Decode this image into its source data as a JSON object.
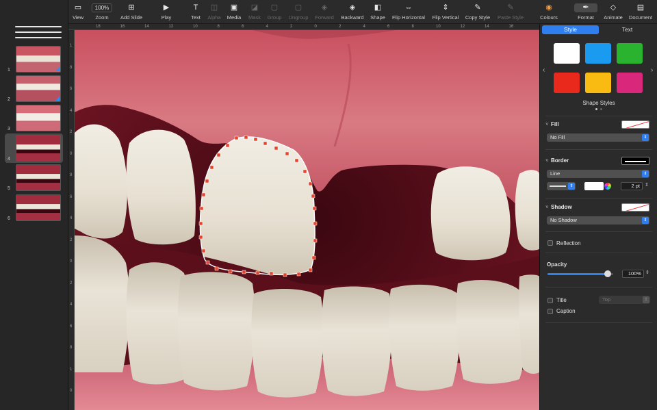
{
  "toolbar": {
    "zoom_value": "100%",
    "items": [
      {
        "label": "View",
        "icon": "sidebar-icon"
      },
      {
        "label": "Zoom",
        "icon": "zoom-icon"
      },
      {
        "label": "Add Slide",
        "icon": "add-slide-icon"
      },
      {
        "label": "Play",
        "icon": "play-icon"
      },
      {
        "label": "Text",
        "icon": "text-icon"
      },
      {
        "label": "Alpha",
        "icon": "alpha-icon"
      },
      {
        "label": "Media",
        "icon": "media-icon"
      },
      {
        "label": "Mask",
        "icon": "mask-icon"
      },
      {
        "label": "Group",
        "icon": "group-icon"
      },
      {
        "label": "Ungroup",
        "icon": "ungroup-icon"
      },
      {
        "label": "Forward",
        "icon": "forward-icon"
      },
      {
        "label": "Backward",
        "icon": "backward-icon"
      },
      {
        "label": "Shape",
        "icon": "shape-icon"
      },
      {
        "label": "Flip Horizontal",
        "icon": "flip-horizontal-icon"
      },
      {
        "label": "Flip Vertical",
        "icon": "flip-vertical-icon"
      },
      {
        "label": "Copy Style",
        "icon": "copy-style-icon"
      },
      {
        "label": "Paste Style",
        "icon": "paste-style-icon"
      },
      {
        "label": "Colours",
        "icon": "colours-icon"
      },
      {
        "label": "Format",
        "icon": "format-icon"
      },
      {
        "label": "Animate",
        "icon": "animate-icon"
      },
      {
        "label": "Document",
        "icon": "document-icon"
      }
    ]
  },
  "slides": [
    {
      "number": "1"
    },
    {
      "number": "2"
    },
    {
      "number": "3"
    },
    {
      "number": "4"
    },
    {
      "number": "5"
    },
    {
      "number": "6"
    }
  ],
  "rulers": {
    "horizontal": [
      "18",
      "16",
      "14",
      "12",
      "10",
      "8",
      "6",
      "4",
      "2",
      "0",
      "2",
      "4",
      "6",
      "8",
      "10",
      "12",
      "14",
      "16"
    ],
    "vertical": [
      "1",
      "8",
      "6",
      "4",
      "2",
      "0",
      "8",
      "6",
      "4",
      "2",
      "0",
      "2",
      "4",
      "6",
      "8",
      "1",
      "0"
    ]
  },
  "inspector": {
    "tabs": {
      "style": "Style",
      "text": "Text"
    },
    "shape_styles_label": "Shape Styles",
    "swatch_colors": [
      "#ffffff",
      "#1a9bf0",
      "#29b32e",
      "#e8291c",
      "#f9bb12",
      "#d9287b"
    ],
    "fill": {
      "label": "Fill",
      "value": "No Fill"
    },
    "border": {
      "label": "Border",
      "value": "Line",
      "width": "2 pt"
    },
    "shadow": {
      "label": "Shadow",
      "value": "No Shadow"
    },
    "reflection": {
      "label": "Reflection"
    },
    "opacity": {
      "label": "Opacity",
      "value": "100%",
      "level": 1.0
    },
    "title": {
      "label": "Title",
      "position": "Top"
    },
    "caption": {
      "label": "Caption"
    }
  }
}
